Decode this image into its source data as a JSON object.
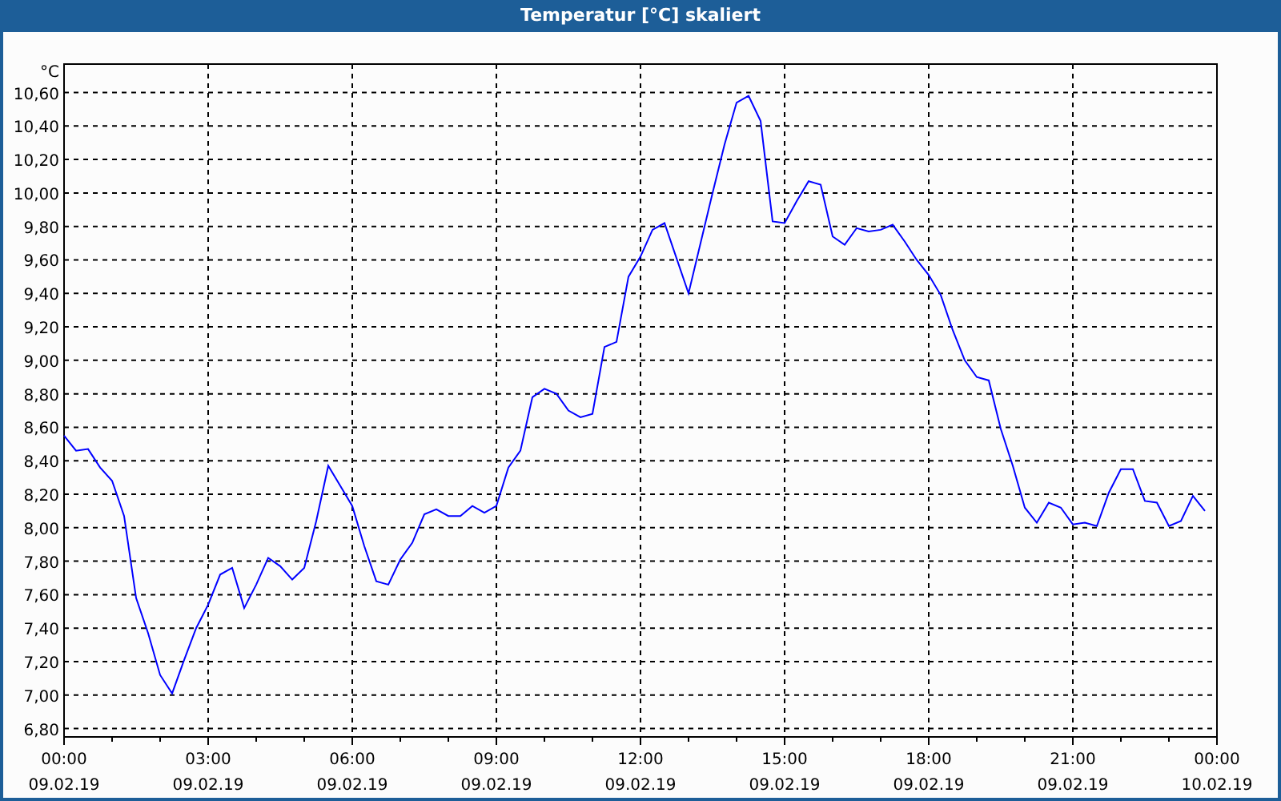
{
  "window": {
    "title": "Temperatur [°C] skaliert"
  },
  "chart": {
    "chart_data": {
      "type": "line",
      "grid": true,
      "ylabel": "°C",
      "categories": [
        "00:00\n09.02.19",
        null,
        null,
        null,
        null,
        null,
        null,
        null,
        null,
        null,
        null,
        null,
        "03:00\n09.02.19",
        null,
        null,
        null,
        null,
        null,
        null,
        null,
        null,
        null,
        null,
        null,
        "06:00\n09.02.19",
        null,
        null,
        null,
        null,
        null,
        null,
        null,
        null,
        null,
        null,
        null,
        "09:00\n09.02.19",
        null,
        null,
        null,
        null,
        null,
        null,
        null,
        null,
        null,
        null,
        null,
        "12:00\n09.02.19",
        null,
        null,
        null,
        null,
        null,
        null,
        null,
        null,
        null,
        null,
        null,
        "15:00\n09.02.19",
        null,
        null,
        null,
        null,
        null,
        null,
        null,
        null,
        null,
        null,
        null,
        "18:00\n09.02.19",
        null,
        null,
        null,
        null,
        null,
        null,
        null,
        null,
        null,
        null,
        null,
        "21:00\n09.02.19",
        null,
        null,
        null,
        null,
        null,
        null,
        null,
        null,
        null,
        null,
        null,
        "00:00\n10.02.19"
      ],
      "series": [
        {
          "color": "#0000ff",
          "values": [
            8.55,
            8.46,
            8.47,
            8.36,
            8.28,
            8.07,
            7.58,
            7.37,
            7.12,
            7.01,
            7.21,
            7.4,
            7.54,
            7.72,
            7.76,
            7.52,
            7.66,
            7.82,
            7.77,
            7.69,
            7.76,
            8.04,
            8.37,
            8.25,
            8.13,
            7.89,
            7.68,
            7.66,
            7.81,
            7.91,
            8.08,
            8.11,
            8.07,
            8.07,
            8.13,
            8.09,
            8.13,
            8.36,
            8.46,
            8.78,
            8.83,
            8.8,
            8.7,
            8.66,
            8.68,
            9.08,
            9.11,
            9.5,
            9.62,
            9.78,
            9.82,
            9.61,
            9.4,
            9.7,
            10.0,
            10.29,
            10.54,
            10.58,
            10.43,
            9.83,
            9.82,
            9.95,
            10.07,
            10.05,
            9.74,
            9.69,
            9.79,
            9.77,
            9.78,
            9.81,
            9.71,
            9.6,
            9.51,
            9.39,
            9.18,
            9.0,
            8.9,
            8.88,
            8.59,
            8.37,
            8.12,
            8.03,
            8.15,
            8.12,
            8.02,
            8.03,
            8.01,
            8.21,
            8.35,
            8.35,
            8.16,
            8.15,
            8.01,
            8.04,
            8.19,
            8.1,
            null
          ]
        }
      ],
      "ylim": [
        6.75,
        10.77
      ],
      "yticks": [
        {
          "value": 6.8,
          "label": "6,80"
        },
        {
          "value": 7.0,
          "label": "7,00"
        },
        {
          "value": 7.2,
          "label": "7,20"
        },
        {
          "value": 7.4,
          "label": "7,40"
        },
        {
          "value": 7.6,
          "label": "7,60"
        },
        {
          "value": 7.8,
          "label": "7,80"
        },
        {
          "value": 8.0,
          "label": "8,00"
        },
        {
          "value": 8.2,
          "label": "8,20"
        },
        {
          "value": 8.4,
          "label": "8,40"
        },
        {
          "value": 8.6,
          "label": "8,60"
        },
        {
          "value": 8.8,
          "label": "8,80"
        },
        {
          "value": 9.0,
          "label": "9,00"
        },
        {
          "value": 9.2,
          "label": "9,20"
        },
        {
          "value": 9.4,
          "label": "9,40"
        },
        {
          "value": 9.6,
          "label": "9,60"
        },
        {
          "value": 9.8,
          "label": "9,80"
        },
        {
          "value": 10.0,
          "label": "10,00"
        },
        {
          "value": 10.2,
          "label": "10,20"
        },
        {
          "value": 10.4,
          "label": "10,40"
        },
        {
          "value": 10.6,
          "label": "10,60"
        }
      ]
    }
  }
}
